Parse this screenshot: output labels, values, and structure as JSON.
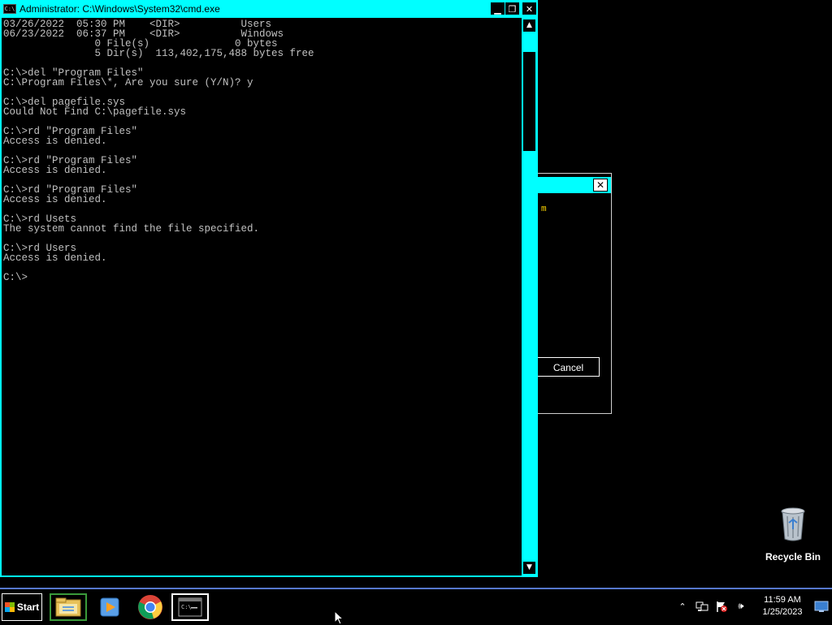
{
  "colors": {
    "window_accent": "#00ffff",
    "console_text": "#c0c0c0",
    "desktop_bg": "#000000",
    "taskbar_border": "#5577cc"
  },
  "cmd_window": {
    "title": "Administrator: C:\\Windows\\System32\\cmd.exe",
    "app_icon_text": "C:\\",
    "minimize_glyph": "▁",
    "maximize_glyph": "❐",
    "close_glyph": "✕",
    "lines": [
      "03/26/2022  05:30 PM    <DIR>          Users",
      "06/23/2022  06:37 PM    <DIR>          Windows",
      "               0 File(s)              0 bytes",
      "               5 Dir(s)  113,402,175,488 bytes free",
      "",
      "C:\\>del \"Program Files\"",
      "C:\\Program Files\\*, Are you sure (Y/N)? y",
      "",
      "C:\\>del pagefile.sys",
      "Could Not Find C:\\pagefile.sys",
      "",
      "C:\\>rd \"Program Files\"",
      "Access is denied.",
      "",
      "C:\\>rd \"Program Files\"",
      "Access is denied.",
      "",
      "C:\\>rd \"Program Files\"",
      "Access is denied.",
      "",
      "C:\\>rd Usets",
      "The system cannot find the file specified.",
      "",
      "C:\\>rd Users",
      "Access is denied.",
      "",
      "C:\\>"
    ],
    "scroll_up_glyph": "▲",
    "scroll_down_glyph": "▼"
  },
  "background_dialog": {
    "close_glyph": "✕",
    "partial_text": "m",
    "cancel_label": "Cancel"
  },
  "desktop": {
    "recycle_bin_label": "Recycle Bin"
  },
  "taskbar": {
    "start_label": "Start",
    "pinned": [
      {
        "name": "file-explorer-icon"
      },
      {
        "name": "media-player-icon"
      },
      {
        "name": "chrome-icon"
      },
      {
        "name": "command-prompt-icon"
      }
    ],
    "tray": {
      "overflow_glyph": "⌃",
      "volume_glyph": "🕪",
      "time": "11:59 AM",
      "date": "1/25/2023"
    }
  }
}
